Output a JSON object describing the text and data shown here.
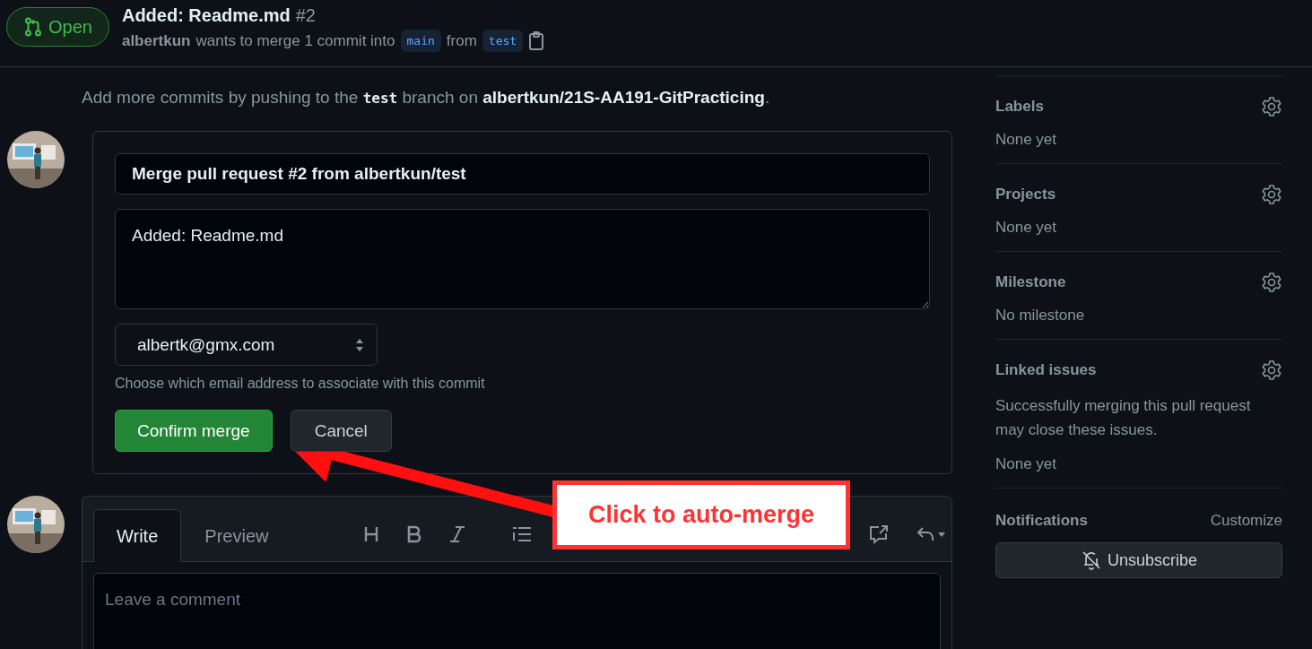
{
  "header": {
    "state": "Open",
    "title": "Added: Readme.md",
    "number": "#2",
    "author": "albertkun",
    "summary_1": "wants to merge 1 commit into",
    "base_branch": "main",
    "summary_2": "from",
    "head_branch": "test"
  },
  "push_hint": [
    {
      "kind": "plain",
      "text": "Add more commits by pushing to the "
    },
    {
      "kind": "code",
      "text": "test"
    },
    {
      "kind": "plain",
      "text": " branch on "
    },
    {
      "kind": "bold",
      "text": "albertkun/21S-AA191-GitPracticing"
    },
    {
      "kind": "plain",
      "text": "."
    }
  ],
  "merge_form": {
    "title_value": "Merge pull request #2 from albertkun/test",
    "message_value": "Added: Readme.md",
    "email": "albertk@gmx.com",
    "email_hint": "Choose which email address to associate with this commit",
    "confirm_button": "Confirm merge",
    "cancel_button": "Cancel"
  },
  "comment": {
    "tabs": [
      {
        "label": "Write",
        "selected": true
      },
      {
        "label": "Preview",
        "selected": false
      }
    ],
    "placeholder": "Leave a comment"
  },
  "sidebar": {
    "sections": [
      {
        "heading": "Labels",
        "value": "None yet"
      },
      {
        "heading": "Projects",
        "value": "None yet"
      },
      {
        "heading": "Milestone",
        "value": "No milestone"
      },
      {
        "heading": "Linked issues",
        "description": "Successfully merging this pull request may close these issues.",
        "value": "None yet"
      }
    ],
    "notifications": {
      "heading": "Notifications",
      "action": "Customize",
      "button": "Unsubscribe"
    }
  },
  "annotation": {
    "text": "Click to auto-merge"
  }
}
